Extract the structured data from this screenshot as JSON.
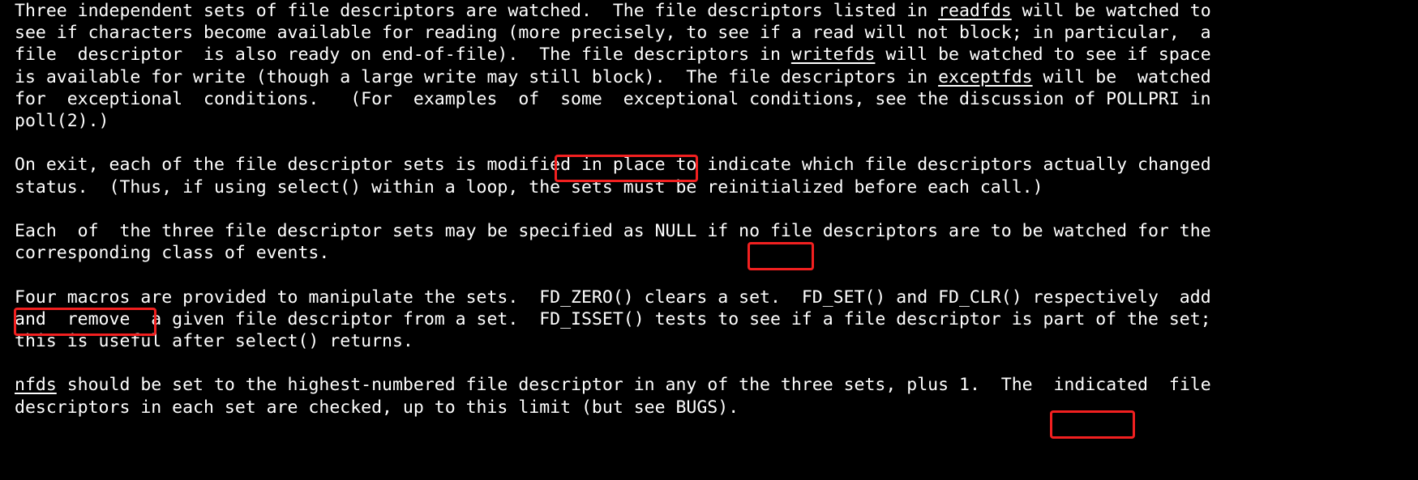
{
  "terminal": {
    "background_color": "#000000",
    "foreground_color": "#ffffff",
    "annotation_color": "#f22020"
  },
  "document": {
    "paragraphs": [
      {
        "id": "p1",
        "lines": [
          [
            {
              "t": "Three independent sets of file descriptors are watched.  The file descriptors listed in ",
              "s": "plain"
            },
            {
              "t": "readfds",
              "s": "underline"
            },
            {
              "t": " will be watched to",
              "s": "plain"
            }
          ],
          [
            {
              "t": "see if characters become available for reading (more precisely, to see if a read will not block; in particular,  a",
              "s": "plain"
            }
          ],
          [
            {
              "t": "file  descriptor  is also ready on end-of-file).  The file descriptors in ",
              "s": "plain"
            },
            {
              "t": "writefds",
              "s": "underline"
            },
            {
              "t": " will be watched to see if space",
              "s": "plain"
            }
          ],
          [
            {
              "t": "is available for write (though a large write may still block).  The file descriptors in ",
              "s": "plain"
            },
            {
              "t": "exceptfds",
              "s": "underline"
            },
            {
              "t": " will be  watched",
              "s": "plain"
            }
          ],
          [
            {
              "t": "for  exceptional  conditions.   (For  examples  of  some  exceptional conditions, see the discussion of POLLPRI in",
              "s": "plain"
            }
          ],
          [
            {
              "t": "poll(2).)",
              "s": "plain"
            }
          ]
        ]
      },
      {
        "id": "p2",
        "lines": [
          [
            {
              "t": "On exit, each of the file descriptor sets is ",
              "s": "plain"
            },
            {
              "t": "modified in place",
              "s": "plain"
            },
            {
              "t": " to indicate which file descriptors actually changed",
              "s": "plain"
            }
          ],
          [
            {
              "t": "status.  (Thus, if using select() within a loop, the sets must be reinitialized before each call.)",
              "s": "plain"
            }
          ]
        ]
      },
      {
        "id": "p3",
        "lines": [
          [
            {
              "t": "Each  of  the three file descriptor sets may be specified as ",
              "s": "plain"
            },
            {
              "t": "NULL",
              "s": "plain"
            },
            {
              "t": " if no file descriptors are to be watched for the",
              "s": "plain"
            }
          ],
          [
            {
              "t": "corresponding class of events.",
              "s": "plain"
            }
          ]
        ]
      },
      {
        "id": "p4",
        "lines": [
          [
            {
              "t": "Four macros",
              "s": "plain"
            },
            {
              "t": " are provided to manipulate the sets.  FD_ZERO() clears a set.  FD_SET() and FD_CLR() respectively  add",
              "s": "plain"
            }
          ],
          [
            {
              "t": "and  remove  a given file descriptor from a set.  FD_ISSET() tests to see if a file descriptor is part of the set;",
              "s": "plain"
            }
          ],
          [
            {
              "t": "this is useful after select() returns.",
              "s": "plain"
            }
          ]
        ]
      },
      {
        "id": "p5",
        "lines": [
          [
            {
              "t": "nfds",
              "s": "underline"
            },
            {
              "t": " should be set to the highest-numbered file descriptor in any of the three sets, ",
              "s": "plain"
            },
            {
              "t": "plus 1",
              "s": "plain"
            },
            {
              "t": ".  The  indicated  file",
              "s": "plain"
            }
          ],
          [
            {
              "t": "descriptors in each set are checked, up to this limit (but see BUGS).",
              "s": "plain"
            }
          ]
        ]
      }
    ],
    "underlined_terms": [
      "readfds",
      "writefds",
      "exceptfds",
      "nfds"
    ],
    "annotations": [
      {
        "id": "modified-in-place",
        "label": "modified in place"
      },
      {
        "id": "null",
        "label": "NULL"
      },
      {
        "id": "four-macros",
        "label": "Four macros"
      },
      {
        "id": "plus-1",
        "label": "plus 1"
      }
    ]
  }
}
